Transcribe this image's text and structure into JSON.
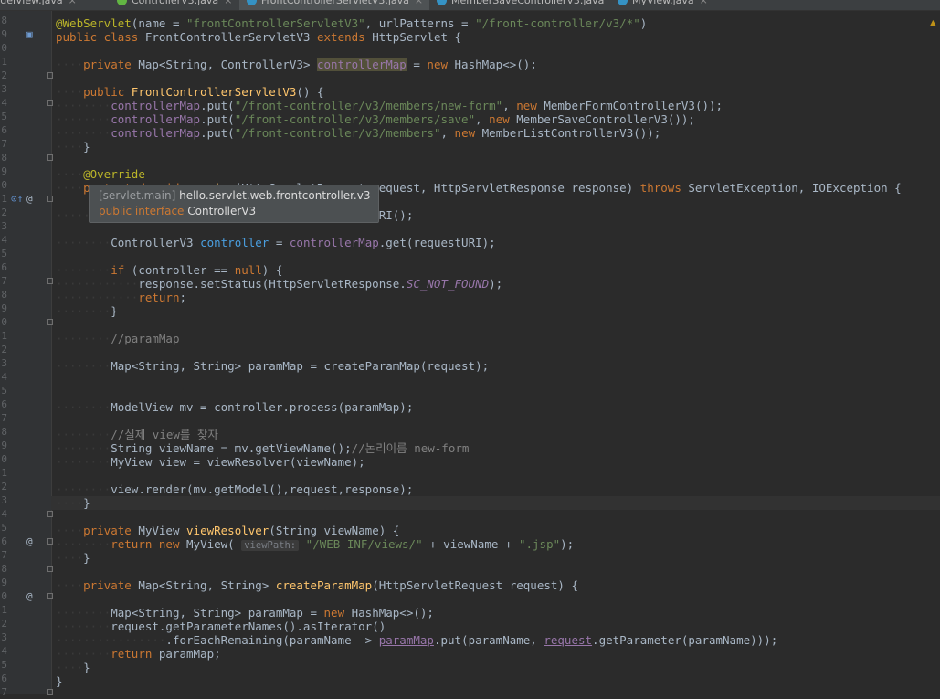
{
  "tabs": [
    {
      "label": "ModelView.java",
      "active": false,
      "icon_color": "#3592c4"
    },
    {
      "label": "ControllerV3.java",
      "active": false,
      "icon_color": "#62b543"
    },
    {
      "label": "FrontControllerServletV3.java",
      "active": true,
      "icon_color": "#3592c4"
    },
    {
      "label": "MemberSaveControllerV3.java",
      "active": false,
      "icon_color": "#3592c4"
    },
    {
      "label": "MyView.java",
      "active": false,
      "icon_color": "#3592c4"
    }
  ],
  "tab_close_glyph": "×",
  "warning_glyph": "▲",
  "line_numbers": [
    "8",
    "9",
    "0",
    "1",
    "2",
    "3",
    "4",
    "5",
    "6",
    "7",
    "8",
    "9",
    "0",
    "1",
    "2",
    "3",
    "4",
    "5",
    "6",
    "7",
    "8",
    "9",
    "0",
    "1",
    "2",
    "3",
    "4",
    "5",
    "6",
    "7",
    "8",
    "9",
    "0",
    "1",
    "2",
    "3",
    "4",
    "5",
    "6",
    "7",
    "8",
    "9",
    "0",
    "1",
    "2",
    "3",
    "4",
    "5",
    "6",
    "7"
  ],
  "gutter_icons": [
    {
      "line": 1,
      "glyph": "▣",
      "icon": "web-servlet-icon",
      "color": "#6f9bd1"
    },
    {
      "line": 13,
      "glyph": "⊙↑",
      "icon": "override-method-icon",
      "color": "#5f8dc8"
    },
    {
      "line": 13,
      "glyph": "@",
      "icon": "annotation-icon",
      "color": "#a9b7c6"
    },
    {
      "line": 38,
      "glyph": "@",
      "icon": "annotation-icon",
      "color": "#a9b7c6"
    },
    {
      "line": 42,
      "glyph": "@",
      "icon": "annotation-icon",
      "color": "#a9b7c6"
    }
  ],
  "fold_lines": [
    4,
    6,
    10,
    13,
    19,
    22,
    36,
    38,
    40,
    42,
    49
  ],
  "current_line": 36,
  "code_lines": [
    [],
    [
      [
        "t-ann",
        "@WebServlet"
      ],
      [
        "t-plain",
        "(name = "
      ],
      [
        "t-str",
        "\"frontControllerServletV3\""
      ],
      [
        "t-plain",
        ", urlPatterns = "
      ],
      [
        "t-str",
        "\"/front-controller/v3/*\""
      ],
      [
        "t-plain",
        ")"
      ]
    ],
    [
      [
        "t-kw",
        "public class "
      ],
      [
        "t-plain",
        "FrontControllerServletV3 "
      ],
      [
        "t-kw",
        "extends "
      ],
      [
        "t-plain",
        "HttpServlet {"
      ]
    ],
    [],
    [
      [
        "ws",
        "····"
      ],
      [
        "t-kw",
        "private "
      ],
      [
        "t-plain",
        "Map<String, ControllerV3> "
      ],
      [
        "t-fieldhl",
        "controllerMap"
      ],
      [
        "t-plain",
        " = "
      ],
      [
        "t-kw",
        "new "
      ],
      [
        "t-plain",
        "HashMap<>();"
      ]
    ],
    [],
    [
      [
        "ws",
        "····"
      ],
      [
        "t-kw",
        "public "
      ],
      [
        "t-fn",
        "FrontControllerServletV3"
      ],
      [
        "t-plain",
        "() {"
      ]
    ],
    [
      [
        "ws",
        "········"
      ],
      [
        "t-field",
        "controllerMap"
      ],
      [
        "t-plain",
        ".put("
      ],
      [
        "t-str",
        "\"/front-controller/v3/members/new-form\""
      ],
      [
        "t-plain",
        ", "
      ],
      [
        "t-kw",
        "new "
      ],
      [
        "t-plain",
        "MemberFormControllerV3());"
      ]
    ],
    [
      [
        "ws",
        "········"
      ],
      [
        "t-field",
        "controllerMap"
      ],
      [
        "t-plain",
        ".put("
      ],
      [
        "t-str",
        "\"/front-controller/v3/members/save\""
      ],
      [
        "t-plain",
        ", "
      ],
      [
        "t-kw",
        "new "
      ],
      [
        "t-plain",
        "MemberSaveControllerV3());"
      ]
    ],
    [
      [
        "ws",
        "········"
      ],
      [
        "t-field",
        "controllerMap"
      ],
      [
        "t-plain",
        ".put("
      ],
      [
        "t-str",
        "\"/front-controller/v3/members\""
      ],
      [
        "t-plain",
        ", "
      ],
      [
        "t-kw",
        "new "
      ],
      [
        "t-plain",
        "MemberListControllerV3());"
      ]
    ],
    [
      [
        "ws",
        "····"
      ],
      [
        "t-plain",
        "}"
      ]
    ],
    [],
    [
      [
        "ws",
        "····"
      ],
      [
        "t-ann",
        "@Override"
      ]
    ],
    [
      [
        "ws",
        "····"
      ],
      [
        "t-kw",
        "protected void "
      ],
      [
        "t-fn",
        "service"
      ],
      [
        "t-plain",
        "(HttpServletRequest request, HttpServletResponse response) "
      ],
      [
        "t-kw",
        "throws "
      ],
      [
        "t-plain",
        "ServletException, IOException {"
      ]
    ],
    [],
    [
      [
        "ws",
        "········"
      ],
      [
        "t-plain",
        "String requestURI = request.getRequestURI();"
      ]
    ],
    [],
    [
      [
        "ws",
        "········"
      ],
      [
        "t-plain",
        "ControllerV3 "
      ],
      [
        "t-localhl",
        "controller"
      ],
      [
        "t-plain",
        " = "
      ],
      [
        "t-field",
        "controllerMap"
      ],
      [
        "t-plain",
        ".get(requestURI);"
      ]
    ],
    [],
    [
      [
        "ws",
        "········"
      ],
      [
        "t-kw",
        "if "
      ],
      [
        "t-plain",
        "(controller == "
      ],
      [
        "t-kw",
        "null"
      ],
      [
        "t-plain",
        ") {"
      ]
    ],
    [
      [
        "ws",
        "············"
      ],
      [
        "t-plain",
        "response.setStatus(HttpServletResponse."
      ],
      [
        "t-const",
        "SC_NOT_FOUND"
      ],
      [
        "t-plain",
        ");"
      ]
    ],
    [
      [
        "ws",
        "············"
      ],
      [
        "t-kw",
        "return"
      ],
      [
        "t-plain",
        ";"
      ]
    ],
    [
      [
        "ws",
        "········"
      ],
      [
        "t-plain",
        "}"
      ]
    ],
    [],
    [
      [
        "ws",
        "········"
      ],
      [
        "t-comment",
        "//paramMap"
      ]
    ],
    [],
    [
      [
        "ws",
        "········"
      ],
      [
        "t-plain",
        "Map<String, String> paramMap = createParamMap(request);"
      ]
    ],
    [],
    [],
    [
      [
        "ws",
        "········"
      ],
      [
        "t-plain",
        "ModelView mv = controller.process(paramMap);"
      ]
    ],
    [],
    [
      [
        "ws",
        "········"
      ],
      [
        "t-comment",
        "//실제 view를 찾자"
      ]
    ],
    [
      [
        "ws",
        "········"
      ],
      [
        "t-plain",
        "String viewName = mv.getViewName();"
      ],
      [
        "t-comment",
        "//논리이름 new-form"
      ]
    ],
    [
      [
        "ws",
        "········"
      ],
      [
        "t-plain",
        "MyView view = viewResolver(viewName);"
      ]
    ],
    [],
    [
      [
        "ws",
        "········"
      ],
      [
        "t-plain",
        "view.render(mv.getModel(),request,response);"
      ]
    ],
    [
      [
        "ws",
        "····"
      ],
      [
        "t-plain",
        "}"
      ]
    ],
    [],
    [
      [
        "ws",
        "····"
      ],
      [
        "t-kw",
        "private "
      ],
      [
        "t-plain",
        "MyView "
      ],
      [
        "t-fn",
        "viewResolver"
      ],
      [
        "t-plain",
        "(String viewName) {"
      ]
    ],
    [
      [
        "ws",
        "········"
      ],
      [
        "t-kw",
        "return new "
      ],
      [
        "t-plain",
        "MyView( "
      ],
      [
        "t-hint",
        "viewPath:"
      ],
      [
        "t-plain",
        " "
      ],
      [
        "t-str",
        "\"/WEB-INF/views/\""
      ],
      [
        "t-plain",
        " + viewName + "
      ],
      [
        "t-str",
        "\".jsp\""
      ],
      [
        "t-plain",
        ");"
      ]
    ],
    [
      [
        "ws",
        "····"
      ],
      [
        "t-plain",
        "}"
      ]
    ],
    [],
    [
      [
        "ws",
        "····"
      ],
      [
        "t-kw",
        "private "
      ],
      [
        "t-plain",
        "Map<String, String> "
      ],
      [
        "t-fn",
        "createParamMap"
      ],
      [
        "t-plain",
        "(HttpServletRequest request) {"
      ]
    ],
    [],
    [
      [
        "ws",
        "········"
      ],
      [
        "t-plain",
        "Map<String, String> paramMap = "
      ],
      [
        "t-kw",
        "new "
      ],
      [
        "t-plain",
        "HashMap<>();"
      ]
    ],
    [
      [
        "ws",
        "········"
      ],
      [
        "t-plain",
        "request.getParameterNames().asIterator()"
      ]
    ],
    [
      [
        "ws",
        "················"
      ],
      [
        "t-plain",
        ".forEachRemaining(paramName -> "
      ],
      [
        "t-under",
        "paramMap"
      ],
      [
        "t-plain",
        ".put(paramName, "
      ],
      [
        "t-under",
        "request"
      ],
      [
        "t-plain",
        ".getParameter(paramName)));"
      ]
    ],
    [
      [
        "ws",
        "········"
      ],
      [
        "t-kw",
        "return "
      ],
      [
        "t-plain",
        "paramMap;"
      ]
    ],
    [
      [
        "ws",
        "····"
      ],
      [
        "t-plain",
        "}"
      ]
    ],
    [
      [
        "t-plain",
        "}"
      ]
    ]
  ],
  "popup": {
    "module": "[servlet.main]",
    "package": "hello.servlet.web.frontcontroller.v3",
    "keyword": "public interface",
    "name": "ControllerV3"
  }
}
